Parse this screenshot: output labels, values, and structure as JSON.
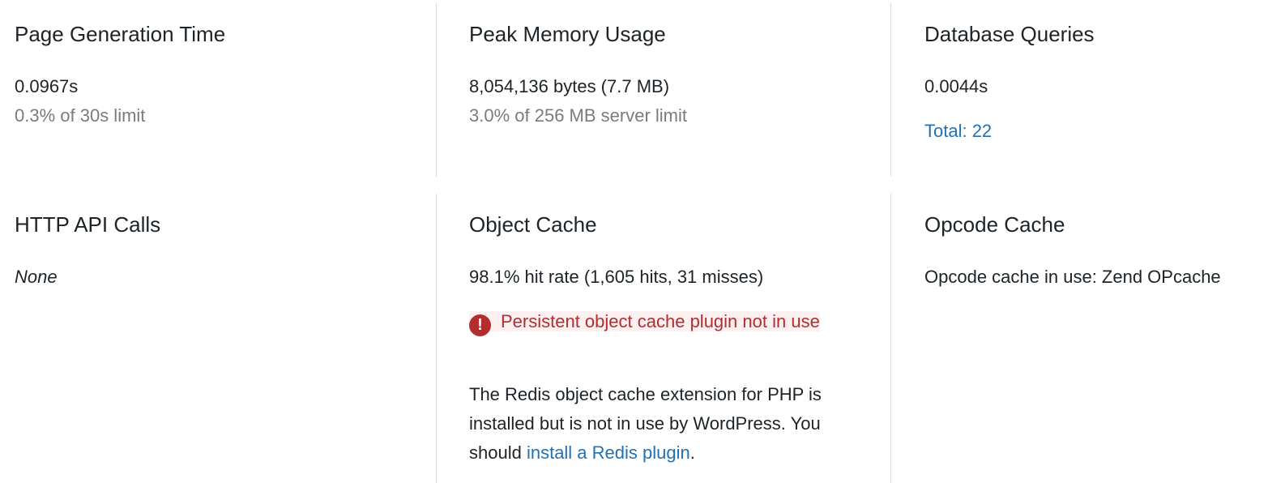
{
  "panels": {
    "page_generation": {
      "title": "Page Generation Time",
      "value": "0.0967s",
      "sub": "0.3% of 30s limit"
    },
    "peak_memory": {
      "title": "Peak Memory Usage",
      "value": "8,054,136 bytes (7.7 MB)",
      "sub": "3.0% of 256 MB server limit"
    },
    "database_queries": {
      "title": "Database Queries",
      "value": "0.0044s",
      "total_link": "Total: 22"
    },
    "http_api_calls": {
      "title": "HTTP API Calls",
      "value": "None"
    },
    "object_cache": {
      "title": "Object Cache",
      "value": "98.1% hit rate (1,605 hits, 31 misses)",
      "warning_icon": "!",
      "warning": "Persistent object cache plugin not in use",
      "para_text": "The Redis object cache extension for PHP is installed but is not in use by WordPress. You should ",
      "para_link": "install a Redis plugin",
      "para_end": "."
    },
    "opcode_cache": {
      "title": "Opcode Cache",
      "value": "Opcode cache in use: Zend OPcache"
    }
  },
  "colors": {
    "text": "#1d2327",
    "muted": "#787c82",
    "link": "#2271b1",
    "error": "#b32d2e",
    "error_bg": "#fcf0f1",
    "divider": "#dcdcde"
  },
  "icons": {
    "warning": "error-exclamation-icon"
  }
}
